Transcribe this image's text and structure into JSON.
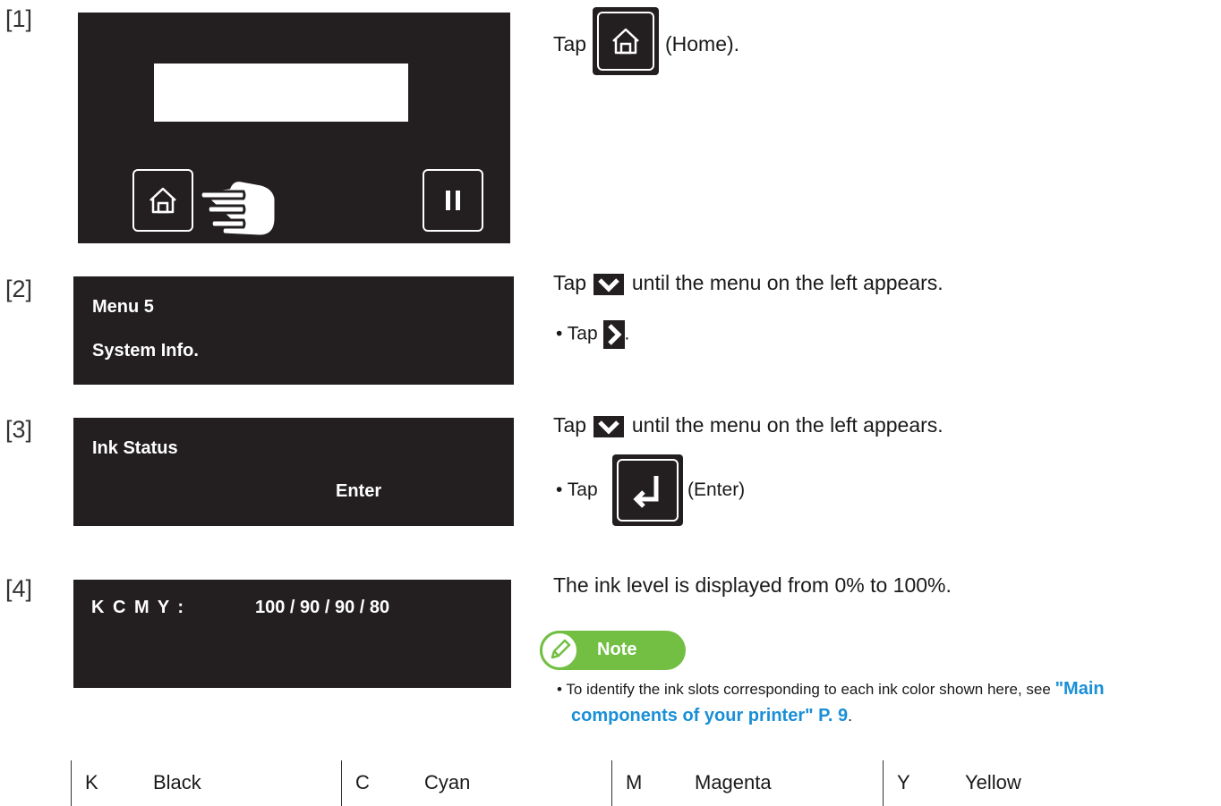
{
  "steps": [
    {
      "number": "[1]",
      "instruction_pre": "Tap",
      "instruction_post": "(Home)."
    },
    {
      "number": "[2]",
      "lcd_line1": "Menu 5",
      "lcd_line2": "System Info.",
      "instruction_pre": "Tap",
      "instruction_post": "until the menu on the left appears.",
      "sub_pre": "• Tap",
      "sub_post": "."
    },
    {
      "number": "[3]",
      "lcd_line1": "Ink Status",
      "lcd_line2": "Enter",
      "instruction_pre": "Tap",
      "instruction_post": "until the menu on the left appears.",
      "sub_pre": "• Tap",
      "sub_post": "(Enter)"
    },
    {
      "number": "[4]",
      "lcd_label": "K C M Y :",
      "lcd_value": "100 / 90 / 90 / 80",
      "instruction": "The ink level is displayed from 0% to 100%."
    }
  ],
  "note": {
    "title": "Note",
    "text_pre": "• To identify the ink slots corresponding to each ink color shown here, see",
    "link_line1": "\"Main",
    "link_line2": "components of your printer\" P. 9",
    "text_post": "."
  },
  "legend": [
    {
      "code": "K",
      "name": "Black"
    },
    {
      "code": "C",
      "name": "Cyan"
    },
    {
      "code": "M",
      "name": "Magenta"
    },
    {
      "code": "Y",
      "name": "Yellow"
    }
  ],
  "colors": {
    "panel": "#231f20",
    "note_green": "#72bf44",
    "link_blue": "#1a8fd6"
  },
  "icons": [
    "home-icon",
    "pause-icon",
    "pointing-hand-icon",
    "chevron-down-icon",
    "chevron-right-icon",
    "enter-icon",
    "pencil-icon"
  ]
}
